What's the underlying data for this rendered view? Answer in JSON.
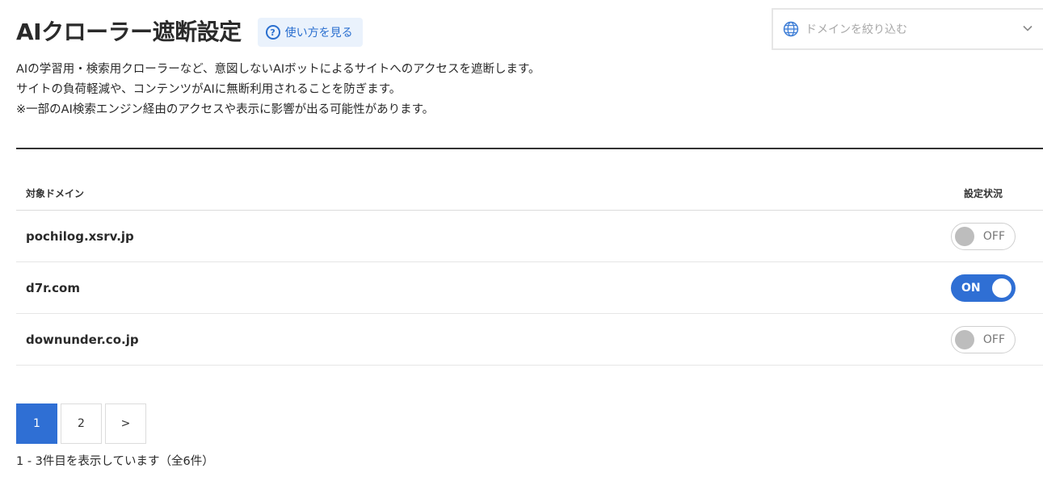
{
  "header": {
    "title": "AIクローラー遮断設定",
    "help_label": "使い方を見る",
    "help_icon": "question-circle-icon"
  },
  "filter": {
    "placeholder": "ドメインを絞り込む",
    "icon": "globe-icon",
    "chevron": "chevron-down-icon"
  },
  "description": {
    "line1": "AIの学習用・検索用クローラーなど、意図しないAIボットによるサイトへのアクセスを遮断します。",
    "line2": "サイトの負荷軽減や、コンテンツがAIに無断利用されることを防ぎます。",
    "line3": "※一部のAI検索エンジン経由のアクセスや表示に影響が出る可能性があります。"
  },
  "table": {
    "col_domain": "対象ドメイン",
    "col_status": "設定状況",
    "rows": [
      {
        "domain": "pochilog.xsrv.jp",
        "status": "OFF"
      },
      {
        "domain": "d7r.com",
        "status": "ON"
      },
      {
        "domain": "downunder.co.jp",
        "status": "OFF"
      }
    ]
  },
  "pagination": {
    "pages": [
      "1",
      "2"
    ],
    "current": "1",
    "next": ">"
  },
  "summary": "1 - 3件目を表示しています（全6件）",
  "colors": {
    "accent": "#2f6fd4",
    "help_bg": "#eaf2fc"
  }
}
